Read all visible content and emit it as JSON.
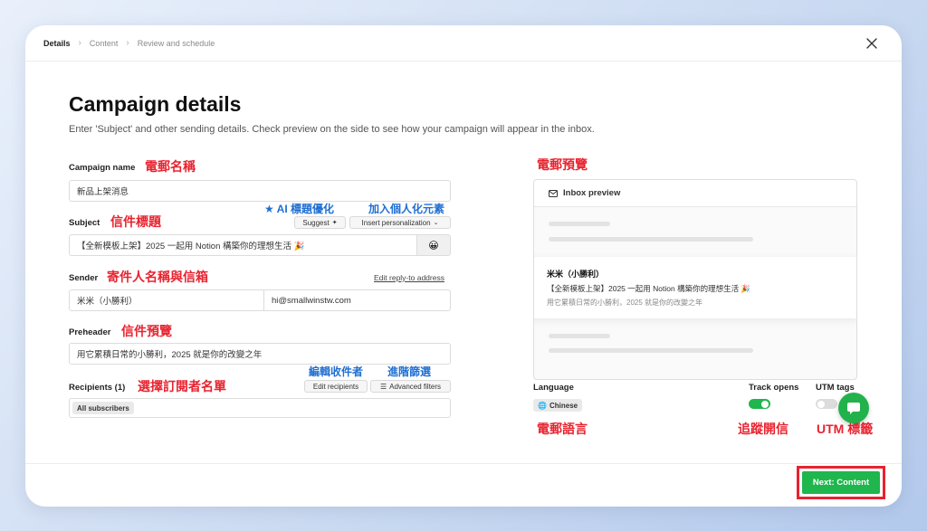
{
  "breadcrumb": [
    "Details",
    "Content",
    "Review and schedule"
  ],
  "page": {
    "title": "Campaign details",
    "subtitle": "Enter 'Subject' and other sending details. Check preview on the side to see how your campaign will appear in the inbox."
  },
  "form": {
    "campaign_name": {
      "label": "Campaign name",
      "value": "新品上架消息"
    },
    "subject": {
      "label": "Subject",
      "value": "【全新模板上架】2025 一起用 Notion 構築你的理想生活 🎉",
      "suggest_label": "Suggest",
      "personalization_label": "Insert personalization",
      "emoji": "😀"
    },
    "sender": {
      "label": "Sender",
      "name": "米米（小勝利）",
      "email": "hi@smallwinstw.com",
      "reply_link": "Edit reply-to address"
    },
    "preheader": {
      "label": "Preheader",
      "value": "用它累積日常的小勝利，2025 就是你的改變之年"
    },
    "recipients": {
      "label": "Recipients (1)",
      "edit_label": "Edit recipients",
      "filter_label": "Advanced filters",
      "chip": "All subscribers"
    }
  },
  "annotations": {
    "campaign_name": "電郵名稱",
    "subject": "信件標題",
    "ai_subject": "★ AI 標題優化",
    "personalization": "加入個人化元素",
    "sender": "寄件人名稱與信箱",
    "preheader": "信件預覽",
    "recipients": "選擇訂閱者名單",
    "edit_recipients": "編輯收件者",
    "advanced_filter": "進階篩選",
    "preview": "電郵預覽",
    "language": "電郵語言",
    "track_opens": "追蹤開信",
    "utm": "UTM 標籤"
  },
  "preview": {
    "header": "Inbox preview",
    "sender": "米米（小勝利）",
    "subject": "【全新模板上架】2025 一起用 Notion 構築你的理想生活 🎉",
    "preheader": "用它累積日常的小勝利，2025 就是你的改變之年"
  },
  "settings": {
    "language_label": "Language",
    "language_value": "Chinese",
    "track_opens_label": "Track opens",
    "track_opens_on": true,
    "utm_label": "UTM tags",
    "utm_on": false
  },
  "footer": {
    "next_label": "Next: Content"
  },
  "colors": {
    "accent_green": "#1fb64d",
    "annotation_red": "#e8232f",
    "annotation_blue": "#1f6fd1"
  }
}
